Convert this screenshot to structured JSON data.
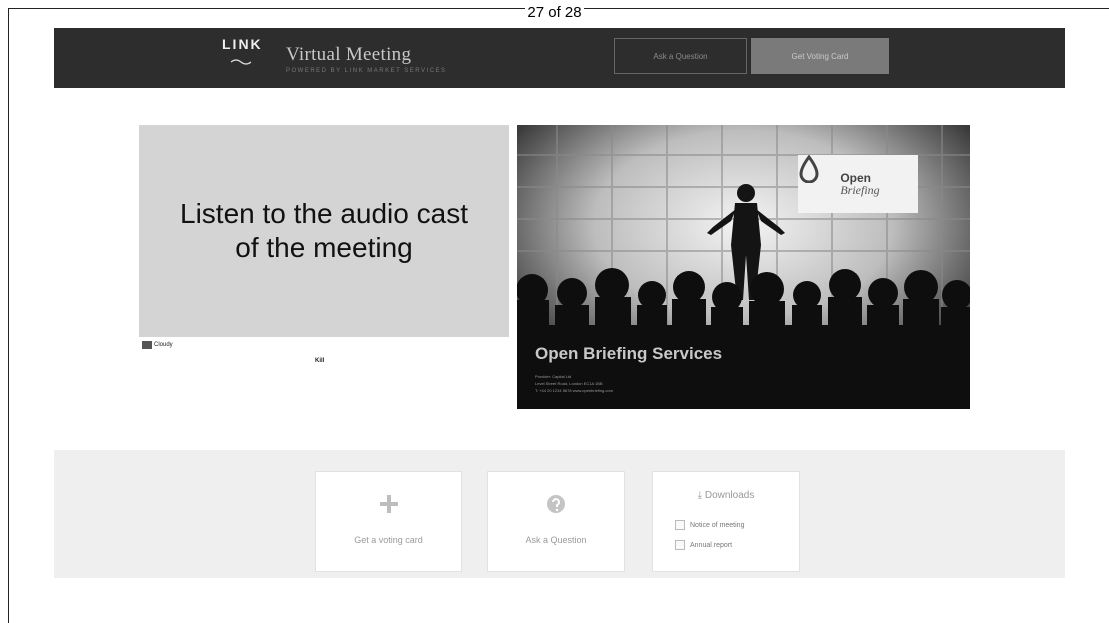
{
  "page_counter": "27 of 28",
  "header": {
    "logo_text": "LINK",
    "title": "Virtual Meeting",
    "subtitle": "POWERED BY LINK MARKET SERVICES",
    "ask_button": "Ask a Question",
    "voting_button": "Get Voting Card"
  },
  "audio": {
    "line1": "Listen to the audio cast",
    "line2": "of the meeting",
    "cloudy_label": "Cloudy",
    "audio_label": "Kill"
  },
  "presenter": {
    "logo_open": "Open",
    "logo_briefing": "Briefing",
    "caption": "Open Briefing Services",
    "small_line1": "Provider: Capital Ltd",
    "small_line2": "Level Street Road, London EC1A 1BB",
    "small_line3": "T: +44 20 1234 5678   www.openbriefing.com"
  },
  "actions": {
    "vote_label": "Get a voting card",
    "ask_label": "Ask a Question",
    "downloads_title": "Downloads",
    "downloads": [
      "Notice of meeting",
      "Annual report"
    ]
  },
  "colors": {
    "topbar": "#2d2d2d",
    "voting_button": "#7a7a7a",
    "audio_panel": "#d4d4d4",
    "bottom_area": "#efefef"
  }
}
